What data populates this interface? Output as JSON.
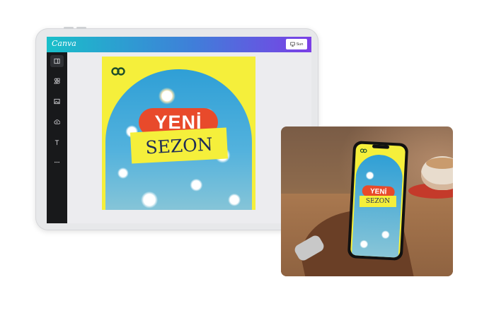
{
  "editor": {
    "brand": "Canva",
    "share_label": "Sun",
    "sidebar": [
      {
        "icon": "layout-icon"
      },
      {
        "icon": "elements-icon"
      },
      {
        "icon": "image-icon"
      },
      {
        "icon": "upload-icon"
      },
      {
        "icon": "text-icon"
      },
      {
        "icon": "more-icon"
      }
    ]
  },
  "design": {
    "line1": "YENİ",
    "line2": "SEZON",
    "colors": {
      "background": "#f5ef3b",
      "pill": "#e84a2b",
      "text": "#1d2b57",
      "sky": "#2f9fd6"
    }
  },
  "mockup": {
    "line1": "YENİ",
    "line2": "SEZON"
  }
}
